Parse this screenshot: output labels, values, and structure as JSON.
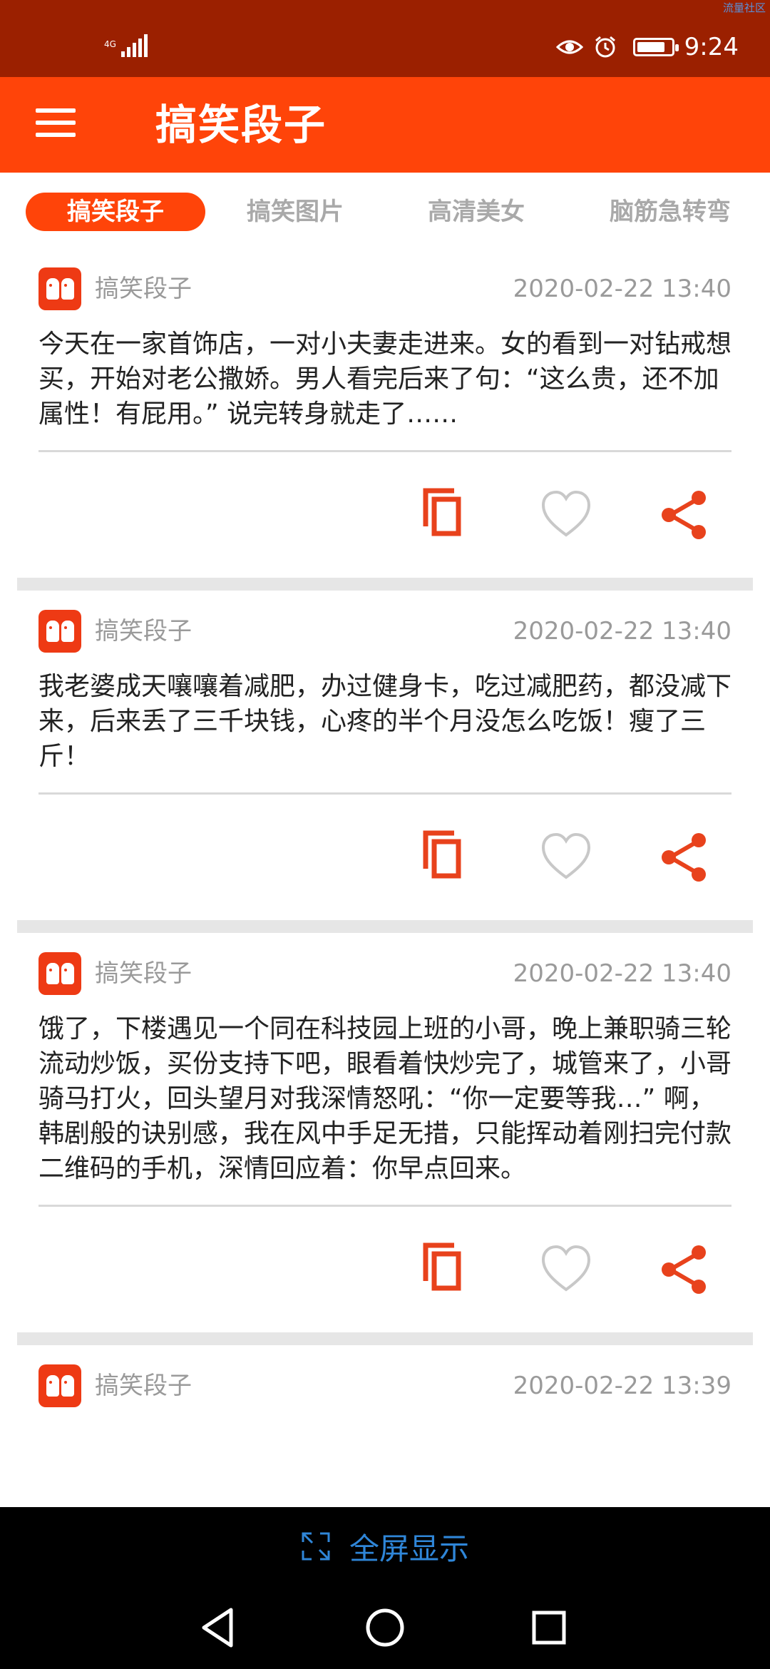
{
  "status_bar": {
    "watermark": "流量社区",
    "network": "4G",
    "time": "9:24"
  },
  "app_bar": {
    "title": "搞笑段子"
  },
  "tabs": [
    {
      "label": "搞笑段子",
      "active": true
    },
    {
      "label": "搞笑图片",
      "active": false
    },
    {
      "label": "高清美女",
      "active": false
    },
    {
      "label": "脑筋急转弯",
      "active": false
    }
  ],
  "posts": [
    {
      "author": "搞笑段子",
      "time": "2020-02-22 13:40",
      "text": "今天在一家首饰店，一对小夫妻走进来。女的看到一对钻戒想买，开始对老公撒娇。男人看完后来了句：“这么贵，还不加属性！有屁用。” 说完转身就走了……"
    },
    {
      "author": "搞笑段子",
      "time": "2020-02-22 13:40",
      "text": "我老婆成天嚷嚷着减肥，办过健身卡，吃过减肥药，都没减下来，后来丢了三千块钱，心疼的半个月没怎么吃饭！瘦了三斤！"
    },
    {
      "author": "搞笑段子",
      "time": "2020-02-22 13:40",
      "text": "饿了，下楼遇见一个同在科技园上班的小哥，晚上兼职骑三轮流动炒饭，买份支持下吧，眼看着快炒完了，城管来了，小哥骑马打火，回头望月对我深情怒吼：“你一定要等我…” 啊，韩剧般的诀别感，我在风中手足无措，只能挥动着刚扫完付款二维码的手机，深情回应着：你早点回来。"
    },
    {
      "author": "搞笑段子",
      "time": "2020-02-22 13:39",
      "text": ""
    }
  ],
  "bottom_bar": {
    "fullscreen_label": "全屏显示"
  },
  "colors": {
    "status_bar": "#9b2000",
    "accent": "#ff4409",
    "fullscreen_text": "#2f86d8"
  }
}
